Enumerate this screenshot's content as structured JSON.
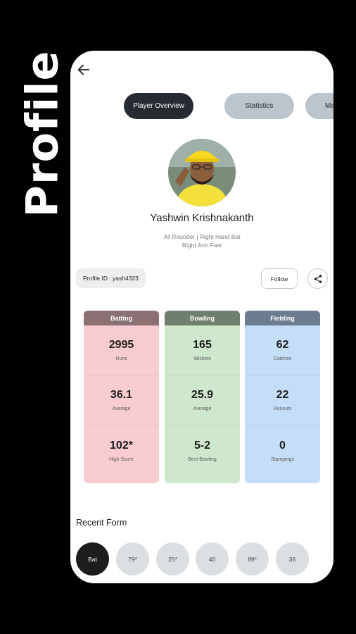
{
  "side_title": "Profile",
  "tabs": [
    {
      "label": "Player Overview",
      "active": true
    },
    {
      "label": "Statistics",
      "active": false
    },
    {
      "label": "Ma",
      "active": false
    }
  ],
  "player": {
    "name": "Yashwin Krishnakanth",
    "role_line1": "All Rounder  |  Right Hand Bat",
    "role_line2": "Right Arm Fast",
    "profile_id": "Profile ID : yash4323"
  },
  "actions": {
    "follow_label": "Follow",
    "share_icon": "share-icon"
  },
  "stats": {
    "batting": {
      "title": "Batting",
      "header_color": "#8b7074",
      "bg_color": "#f8ccd0",
      "items": [
        {
          "value": "2995",
          "label": "Runs"
        },
        {
          "value": "36.1",
          "label": "Average"
        },
        {
          "value": "102*",
          "label": "High Score"
        }
      ]
    },
    "bowling": {
      "title": "Bowling",
      "header_color": "#6f7f6f",
      "bg_color": "#cfe8cd",
      "items": [
        {
          "value": "165",
          "label": "Wickets"
        },
        {
          "value": "25.9",
          "label": "Average"
        },
        {
          "value": "5-2",
          "label": "Best Bowling"
        }
      ]
    },
    "fielding": {
      "title": "Fielding",
      "header_color": "#6d7c8f",
      "bg_color": "#c4def8",
      "items": [
        {
          "value": "62",
          "label": "Catches"
        },
        {
          "value": "22",
          "label": "Runouts"
        },
        {
          "value": "0",
          "label": "Stampings"
        }
      ]
    }
  },
  "recent_form": {
    "title": "Recent Form",
    "chips": [
      "Bat",
      "79*",
      "25*",
      "40",
      "89*",
      "36"
    ]
  }
}
